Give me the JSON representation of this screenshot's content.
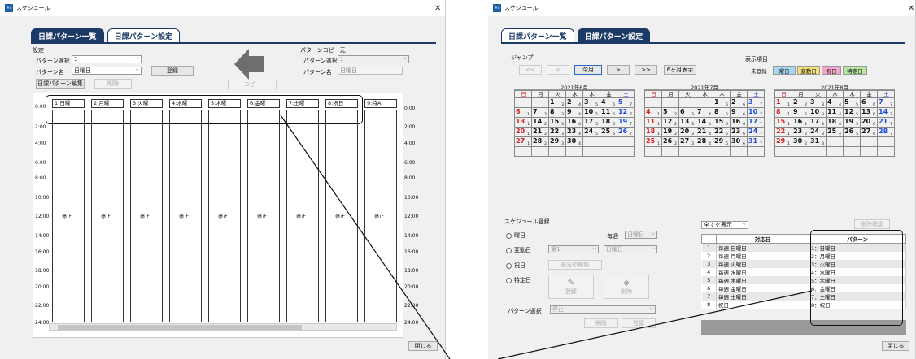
{
  "left": {
    "title": "スケジュール",
    "tabs": [
      "日課パターン一覧",
      "日課パターン設定"
    ],
    "settings": {
      "group": "設定",
      "pattern_select_label": "パターン選択",
      "pattern_select_value": "1",
      "pattern_name_label": "パターン名",
      "pattern_name_value": "日曜日",
      "register": "登録",
      "edit": "日課パターン編集",
      "delete": "削除",
      "copy": "コピー"
    },
    "copy_src": {
      "group": "パターンコピー元",
      "pattern_select_label": "パターン選択",
      "pattern_select_value": "1",
      "pattern_name_label": "パターン名",
      "pattern_name_value": "日曜日"
    },
    "columns": [
      "1:日曜",
      "2:月曜",
      "3:火曜",
      "4:水曜",
      "5:木曜",
      "6:金曜",
      "7:土曜",
      "8:祝日",
      "9:特A"
    ],
    "stop": "停止",
    "times": [
      "0:00",
      "2:00",
      "4:00",
      "6:00",
      "8:00",
      "10:00",
      "12:00",
      "14:00",
      "16:00",
      "18:00",
      "20:00",
      "22:00",
      "24:00"
    ],
    "close": "閉じる"
  },
  "right": {
    "title": "スケジュール",
    "tabs": [
      "日課パターン一覧",
      "日課パターン設定"
    ],
    "jump": {
      "label": "ジャンプ",
      "prev2": "<<",
      "prev": "<",
      "today": "今月",
      "next": ">",
      "next2": ">>",
      "six": "6ヶ月表示"
    },
    "legend": {
      "label": "表示項目",
      "items": [
        {
          "text": "未登録",
          "color": "#ffffff"
        },
        {
          "text": "曜日",
          "color": "#a8d8f0"
        },
        {
          "text": "変動日",
          "color": "#f5e07a"
        },
        {
          "text": "祝日",
          "color": "#f4a6c6"
        },
        {
          "text": "特定日",
          "color": "#b8e8a0"
        }
      ]
    },
    "weekdays": [
      "日",
      "月",
      "火",
      "水",
      "木",
      "金",
      "土"
    ],
    "calendars": [
      {
        "title": "2021年6月",
        "offset": 2,
        "days": 30
      },
      {
        "title": "2021年7月",
        "offset": 4,
        "days": 31
      },
      {
        "title": "2021年8月",
        "offset": 0,
        "days": 31
      }
    ],
    "reg": {
      "group": "スケジュール登録",
      "opt_weekday": "曜日",
      "every_week": "毎週",
      "weekday_value": "日曜日",
      "opt_var": "変動日",
      "var_nth": "第1",
      "var_day": "日曜日",
      "opt_holiday": "祝日",
      "holiday_edit": "祝日の編集",
      "opt_special": "特定日",
      "register": "登録",
      "delete": "削除",
      "pattern_select_label": "パターン選択",
      "pattern_select_value": "停止",
      "del2": "削除",
      "reg2": "登録"
    },
    "filter": "全てを表示",
    "confirm_delete": "削除確認",
    "table": {
      "headers": [
        "対応日",
        "パターン"
      ],
      "rows": [
        [
          "1",
          "毎週",
          "日曜日",
          "1：日曜日"
        ],
        [
          "2",
          "毎週",
          "月曜日",
          "2：月曜日"
        ],
        [
          "3",
          "毎週",
          "火曜日",
          "3：火曜日"
        ],
        [
          "4",
          "毎週",
          "水曜日",
          "4：水曜日"
        ],
        [
          "5",
          "毎週",
          "木曜日",
          "5：木曜日"
        ],
        [
          "6",
          "毎週",
          "金曜日",
          "6：金曜日"
        ],
        [
          "7",
          "毎週",
          "土曜日",
          "7：土曜日"
        ],
        [
          "8",
          "祝日",
          "",
          "8：祝日"
        ]
      ]
    },
    "close": "閉じる"
  }
}
